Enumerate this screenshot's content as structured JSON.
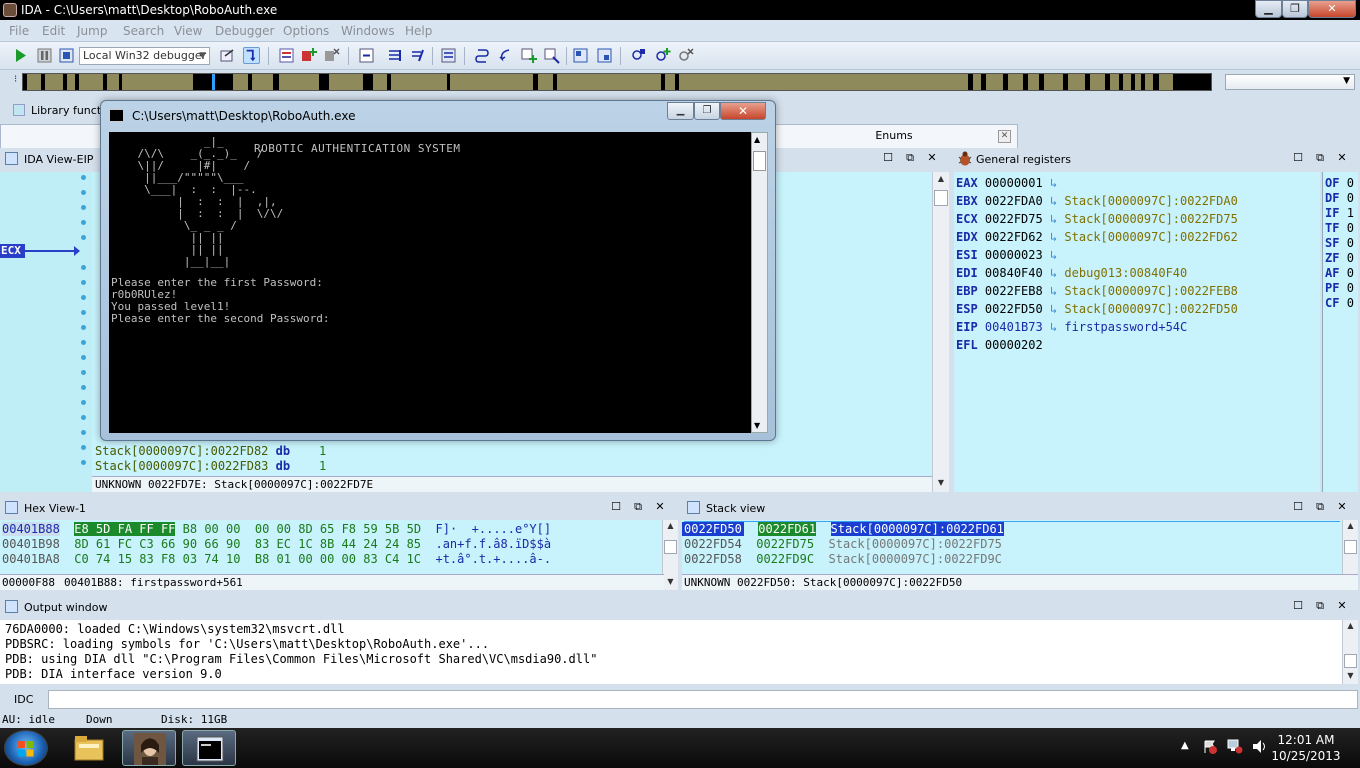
{
  "window": {
    "title": "IDA - C:\\Users\\matt\\Desktop\\RoboAuth.exe",
    "buttons": {
      "minimize": "▁",
      "restore": "❐",
      "close": "✕"
    }
  },
  "menu": [
    "File",
    "Edit",
    "Jump",
    "Search",
    "View",
    "Debugger",
    "Options",
    "Windows",
    "Help"
  ],
  "toolbar": {
    "debugger_select": "Local Win32 debugger"
  },
  "legend": {
    "label": "Library function"
  },
  "tabs": {
    "enums": "Enums"
  },
  "ida_view": {
    "title": "IDA View-EIP",
    "ecx_label": "ECX",
    "lines": [
      {
        "addr": "Stack[0000097C]:0022FD82",
        "op": "db",
        "val": "1"
      },
      {
        "addr": "Stack[0000097C]:0022FD83",
        "op": "db",
        "val": "1"
      }
    ],
    "status": "UNKNOWN 0022FD7E: Stack[0000097C]:0022FD7E"
  },
  "registers": {
    "title": "General registers",
    "rows": [
      {
        "name": "EAX",
        "value": "00000001",
        "ref": ""
      },
      {
        "name": "EBX",
        "value": "0022FDA0",
        "ref": "Stack[0000097C]:0022FDA0"
      },
      {
        "name": "ECX",
        "value": "0022FD75",
        "ref": "Stack[0000097C]:0022FD75"
      },
      {
        "name": "EDX",
        "value": "0022FD62",
        "ref": "Stack[0000097C]:0022FD62"
      },
      {
        "name": "ESI",
        "value": "00000023",
        "ref": ""
      },
      {
        "name": "EDI",
        "value": "00840F40",
        "ref": "debug013:00840F40"
      },
      {
        "name": "EBP",
        "value": "0022FEB8",
        "ref": "Stack[0000097C]:0022FEB8"
      },
      {
        "name": "ESP",
        "value": "0022FD50",
        "ref": "Stack[0000097C]:0022FD50"
      },
      {
        "name": "EIP",
        "value": "00401B73",
        "ref": "firstpassword+54C"
      },
      {
        "name": "EFL",
        "value": "00000202",
        "ref": ""
      }
    ],
    "flags": [
      {
        "name": "OF",
        "value": "0"
      },
      {
        "name": "DF",
        "value": "0"
      },
      {
        "name": "IF",
        "value": "1"
      },
      {
        "name": "TF",
        "value": "0"
      },
      {
        "name": "SF",
        "value": "0"
      },
      {
        "name": "ZF",
        "value": "0"
      },
      {
        "name": "AF",
        "value": "0"
      },
      {
        "name": "PF",
        "value": "0"
      },
      {
        "name": "CF",
        "value": "0"
      }
    ]
  },
  "hex_view": {
    "title": "Hex View-1",
    "rows": [
      {
        "addr": "00401B88",
        "hl": "E8 5D FA FF FF",
        "bytes": "B8 00 00  00 00 8D 65 F8 59 5B 5D",
        "ascii": "F]·  +.....e°Y[]"
      },
      {
        "addr": "00401B98",
        "hl": "",
        "bytes": "8D 61 FC C3 66 90 66 90  83 EC 1C 8B 44 24 24 85",
        "ascii": ".an+f.f.â8.ïD$$à"
      },
      {
        "addr": "00401BA8",
        "hl": "",
        "bytes": "C0 74 15 83 F8 03 74 10  B8 01 00 00 00 83 C4 1C",
        "ascii": "+t.â°.t.+....â-."
      }
    ],
    "status_offset": "00000F88",
    "status_loc": "00401B88: firstpassword+561"
  },
  "stack_view": {
    "title": "Stack view",
    "rows": [
      {
        "addr": "0022FD50",
        "val": "0022FD61",
        "ref": "Stack[0000097C]:0022FD61"
      },
      {
        "addr": "0022FD54",
        "val": "0022FD75",
        "ref": "Stack[0000097C]:0022FD75"
      },
      {
        "addr": "0022FD58",
        "val": "0022FD9C",
        "ref": "Stack[0000097C]:0022FD9C"
      }
    ],
    "status": "UNKNOWN 0022FD50: Stack[0000097C]:0022FD50"
  },
  "output": {
    "title": "Output window",
    "lines": [
      "76DA0000: loaded C:\\Windows\\system32\\msvcrt.dll",
      "PDBSRC: loading symbols for 'C:\\Users\\matt\\Desktop\\RoboAuth.exe'...",
      "PDB: using DIA dll \"C:\\Program Files\\Common Files\\Microsoft Shared\\VC\\msdia90.dll\"",
      "PDB: DIA interface version 9.0"
    ],
    "idc_label": "IDC"
  },
  "status": {
    "au": "AU:  idle",
    "dir": "Down",
    "disk": "Disk: 11GB"
  },
  "console": {
    "title": "C:\\Users\\matt\\Desktop\\RoboAuth.exe",
    "heading": "ROBOTIC AUTHENTICATION SYSTEM",
    "art": [
      "              _|_",
      "    /\\/\\    _(_._)_   /",
      "    \\||/     |#|    /",
      "     ||___/\"\"\"\"\"\\___",
      "     \\___|  :  :  |--.",
      "          |  :  :  |  ,|,",
      "          |  :  :  |  \\/\\/",
      "           \\_ _ _ /",
      "            || ||",
      "            || ||",
      "           |__|__|"
    ],
    "lines": [
      "Please enter the first Password:",
      "r0b0RUlez!",
      "You passed level1!",
      "Please enter the second Password:"
    ]
  },
  "clock": {
    "time": "12:01 AM",
    "date": "10/25/2013"
  }
}
